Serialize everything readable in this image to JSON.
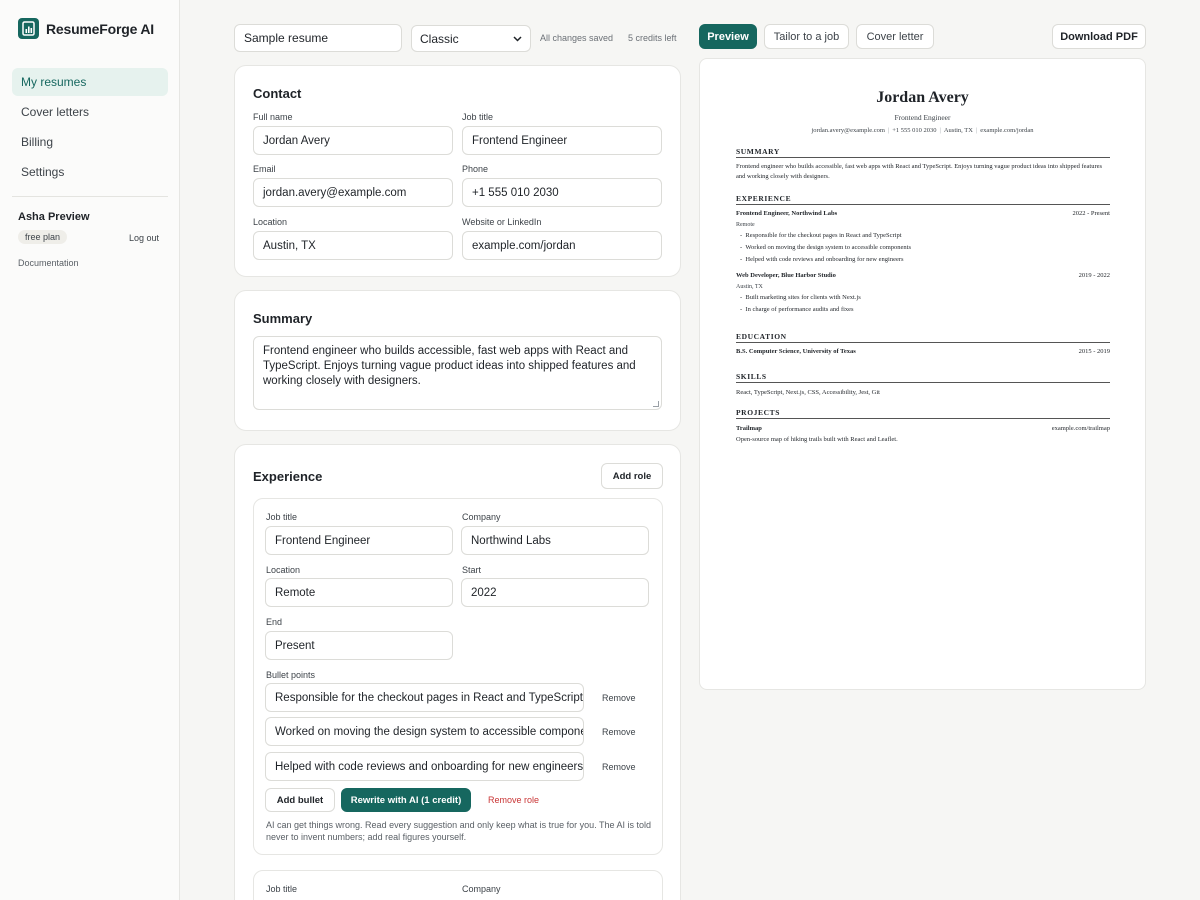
{
  "brand": {
    "name": "ResumeForge AI"
  },
  "sidebar": {
    "nav": [
      {
        "label": "My resumes",
        "active": true
      },
      {
        "label": "Cover letters",
        "active": false
      },
      {
        "label": "Billing",
        "active": false
      },
      {
        "label": "Settings",
        "active": false
      }
    ],
    "user": {
      "name": "Asha Preview",
      "plan": "free plan",
      "logout": "Log out"
    },
    "docs": "Documentation"
  },
  "topbar": {
    "resume_name": "Sample resume",
    "template": "Classic",
    "saved_status": "All changes saved",
    "credits": "5 credits left",
    "preview": "Preview",
    "tailor": "Tailor to a job",
    "cover_letter": "Cover letter",
    "download": "Download PDF"
  },
  "contact": {
    "title": "Contact",
    "full_name_label": "Full name",
    "full_name": "Jordan Avery",
    "job_title_label": "Job title",
    "job_title": "Frontend Engineer",
    "email_label": "Email",
    "email": "jordan.avery@example.com",
    "phone_label": "Phone",
    "phone": "+1 555 010 2030",
    "location_label": "Location",
    "location": "Austin, TX",
    "website_label": "Website or LinkedIn",
    "website": "example.com/jordan"
  },
  "summary": {
    "title": "Summary",
    "text": "Frontend engineer who builds accessible, fast web apps with React and TypeScript. Enjoys turning vague product ideas into shipped features and working closely with designers."
  },
  "experience": {
    "title": "Experience",
    "add_role": "Add role",
    "role1": {
      "job_title_label": "Job title",
      "job_title": "Frontend Engineer",
      "company_label": "Company",
      "company": "Northwind Labs",
      "location_label": "Location",
      "location": "Remote",
      "start_label": "Start",
      "start": "2022",
      "end_label": "End",
      "end": "Present",
      "bullets_label": "Bullet points",
      "bullets": [
        "Responsible for the checkout pages in React and TypeScript",
        "Worked on moving the design system to accessible components",
        "Helped with code reviews and onboarding for new engineers"
      ],
      "remove": "Remove",
      "add_bullet": "Add bullet",
      "rewrite": "Rewrite with AI (1 credit)",
      "remove_role": "Remove role",
      "ai_note": "AI can get things wrong. Read every suggestion and only keep what is true for you. The AI is told never to invent numbers; add real figures yourself."
    },
    "role2": {
      "job_title_label": "Job title",
      "company_label": "Company"
    }
  },
  "preview": {
    "name": "Jordan Avery",
    "role": "Frontend Engineer",
    "contact": [
      "jordan.avery@example.com",
      "+1 555 010 2030",
      "Austin, TX",
      "example.com/jordan"
    ],
    "summary_h": "SUMMARY",
    "summary": "Frontend engineer who builds accessible, fast web apps with React and TypeScript. Enjoys turning vague product ideas into shipped features and working closely with designers.",
    "experience_h": "EXPERIENCE",
    "jobs": [
      {
        "title": "Frontend Engineer, Northwind Labs",
        "dates": "2022 - Present",
        "loc": "Remote",
        "bullets": [
          "Responsible for the checkout pages in React and TypeScript",
          "Worked on moving the design system to accessible components",
          "Helped with code reviews and onboarding for new engineers"
        ]
      },
      {
        "title": "Web Developer, Blue Harbor Studio",
        "dates": "2019 - 2022",
        "loc": "Austin, TX",
        "bullets": [
          "Built marketing sites for clients with Next.js",
          "In charge of performance audits and fixes"
        ]
      }
    ],
    "education_h": "EDUCATION",
    "education": {
      "degree": "B.S. Computer Science, University of Texas",
      "dates": "2015 - 2019"
    },
    "skills_h": "SKILLS",
    "skills": "React, TypeScript, Next.js, CSS, Accessibility, Jest, Git",
    "projects_h": "PROJECTS",
    "project": {
      "name": "Trailmap",
      "url": "example.com/trailmap",
      "desc": "Open-source map of hiking trails built with React and Leaflet."
    }
  }
}
